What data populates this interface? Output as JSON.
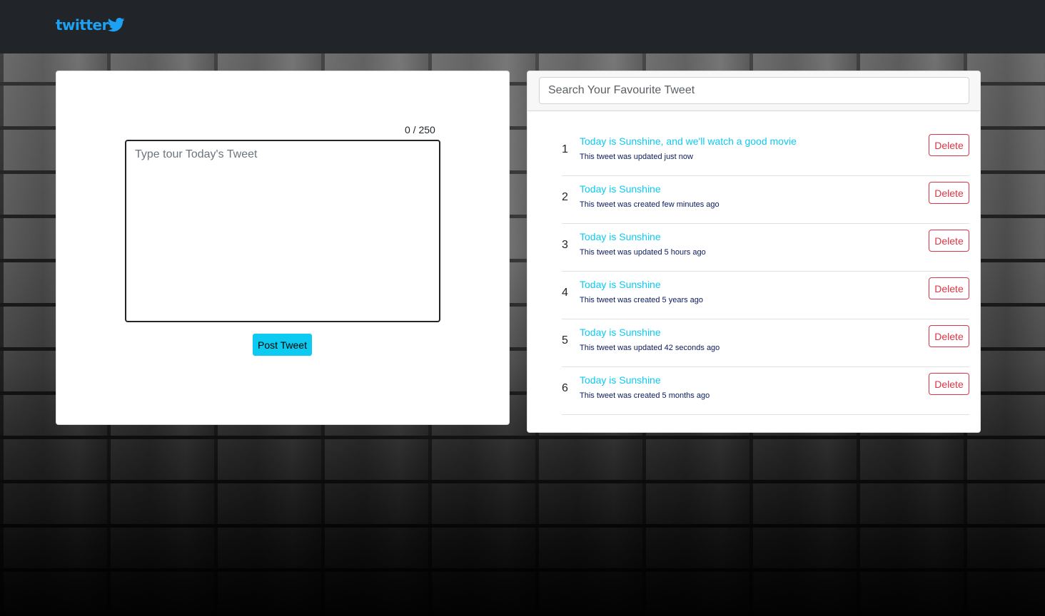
{
  "navbar": {
    "logo_text": "twitter",
    "brand_color": "#1da1f2",
    "logo_icon": "twitter-bird-icon"
  },
  "compose": {
    "counter": "0 / 250",
    "textarea_placeholder": "Type tour Today's Tweet",
    "textarea_value": "",
    "post_label": "Post Tweet",
    "accent_color": "#0dcaf0"
  },
  "list": {
    "search_placeholder": "Search Your Favourite Tweet",
    "delete_label": "Delete",
    "tweets": [
      {
        "index": "1",
        "text": "Today is Sunshine, and we'll watch a good movie",
        "meta": "This tweet was updated just now"
      },
      {
        "index": "2",
        "text": "Today is Sunshine",
        "meta": "This tweet was created few minutes ago"
      },
      {
        "index": "3",
        "text": "Today is Sunshine",
        "meta": "This tweet was updated 5 hours ago"
      },
      {
        "index": "4",
        "text": "Today is Sunshine",
        "meta": "This tweet was created 5 years ago"
      },
      {
        "index": "5",
        "text": "Today is Sunshine",
        "meta": "This tweet was updated 42 seconds ago"
      },
      {
        "index": "6",
        "text": "Today is Sunshine",
        "meta": "This tweet was created 5 months ago"
      }
    ],
    "delete_color": "#dc3545"
  }
}
